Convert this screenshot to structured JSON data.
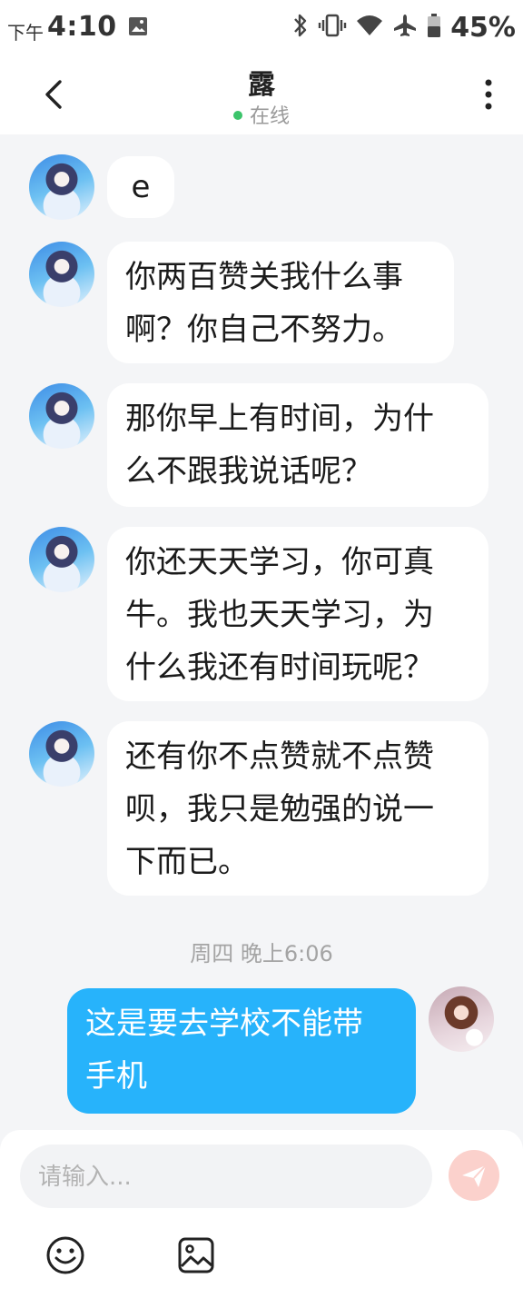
{
  "status_bar": {
    "time_prefix": "下午",
    "time": "4:10",
    "battery": "45%",
    "icons": [
      "photo-icon",
      "bluetooth-icon",
      "vibrate-icon",
      "wifi-icon",
      "airplane-icon",
      "battery-icon"
    ]
  },
  "header": {
    "title": "露",
    "status": "在线",
    "status_color": "#3cc46b"
  },
  "messages": [
    {
      "from": "other",
      "text": "e"
    },
    {
      "from": "other",
      "lines": [
        "你两百赞关我什么事",
        "啊？你自己不努力。"
      ]
    },
    {
      "from": "other",
      "lines": [
        "那你早上有时间，为什",
        "么不跟我说话呢？"
      ]
    },
    {
      "from": "other",
      "lines": [
        "你还天天学习，你可真",
        "牛。我也天天学习，为",
        "什么我还有时间玩呢？"
      ]
    },
    {
      "from": "other",
      "lines": [
        "还有你不点赞就不点赞",
        "呗，我只是勉强的说一",
        "下而已。"
      ]
    },
    {
      "from": "me",
      "lines": [
        "这是要去学校不能带",
        "手机"
      ]
    }
  ],
  "time_separator": "周四 晚上6:06",
  "input": {
    "placeholder": "请输入..."
  },
  "colors": {
    "my_bubble": "#27b3fb",
    "other_bubble": "#ffffff",
    "send_button": "#fbd1cc",
    "background": "#f4f5f7"
  }
}
